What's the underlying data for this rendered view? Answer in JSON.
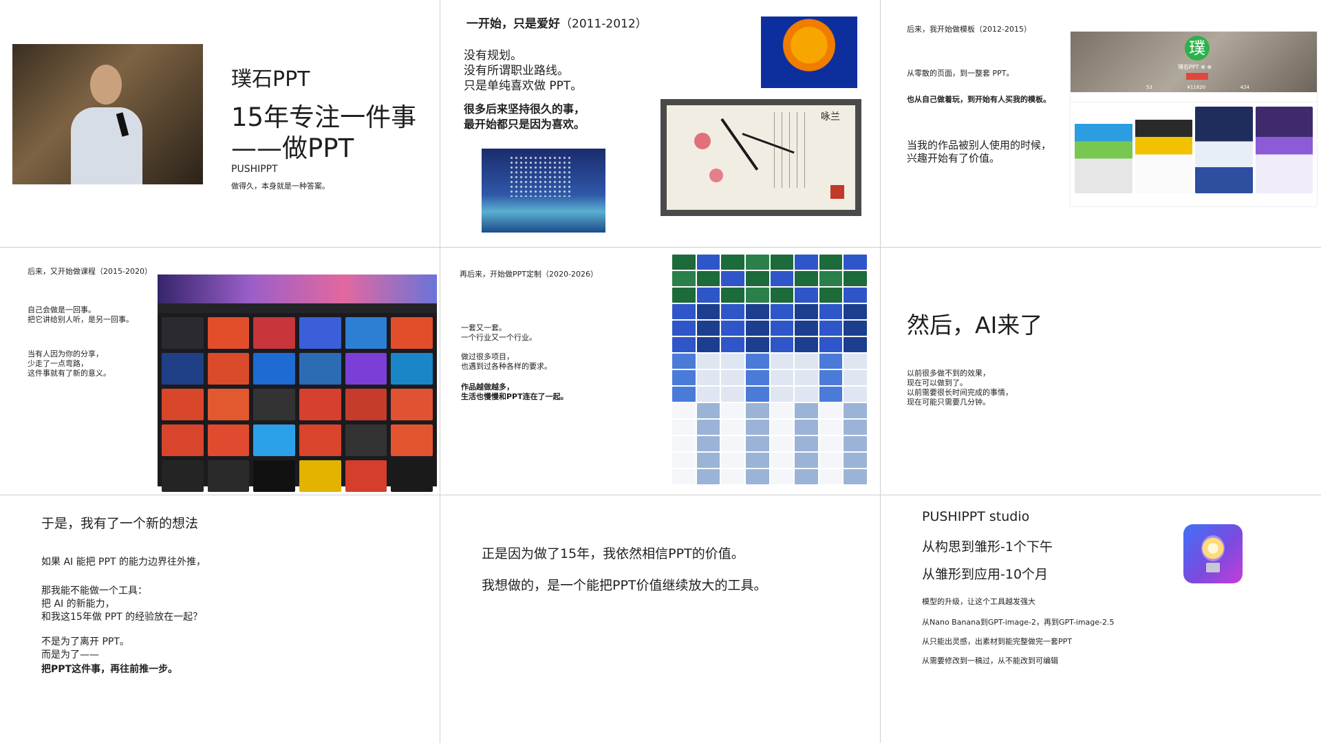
{
  "slide1": {
    "brand": "璞石PPT",
    "title_line1": "15年专注一件事",
    "title_line2": "——做PPT",
    "subtitle": "PUSHIPPT",
    "tagline": "做得久，本身就是一种答案。"
  },
  "slide2": {
    "heading_bold": "一开始，只是爱好",
    "heading_years": "（2011-2012）",
    "lines": [
      "没有规划。",
      "没有所谓职业路线。",
      "只是单纯喜欢做 PPT。"
    ],
    "bold_lines": [
      "很多后来坚持很久的事，",
      "最开始都只是因为喜欢。"
    ],
    "ink_title": "咏兰"
  },
  "slide3": {
    "heading": "后来，我开始做模板（2012-2015）",
    "line1": "从零散的页面，到一整套 PPT。",
    "bold_line": "也从自己做着玩，到开始有人买我的模板。",
    "lines2": [
      "当我的作品被别人使用的时候，",
      "兴趣开始有了价值。"
    ],
    "site": {
      "logo": "璞",
      "name": "璞石PPT ⊕ ⊕",
      "stats": [
        "53",
        "¥11820",
        "424"
      ]
    }
  },
  "slide4": {
    "heading": "后来，又开始做课程（2015-2020）",
    "lines1": [
      "自己会做是一回事。",
      "把它讲给别人听，是另一回事。"
    ],
    "lines2": [
      "当有人因为你的分享，",
      "少走了一点弯路，",
      "这件事就有了新的意义。"
    ]
  },
  "slide5": {
    "heading": "再后来，开始做PPT定制（2020-2026）",
    "lines1": [
      "一套又一套。",
      "一个行业又一个行业。"
    ],
    "lines2": [
      "做过很多项目，",
      "也遇到过各种各样的要求。"
    ],
    "bold_lines": [
      "作品越做越多，",
      "生活也慢慢和PPT连在了一起。"
    ]
  },
  "slide6": {
    "heading": "然后，AI来了",
    "lines": [
      "以前很多做不到的效果，",
      "现在可以做到了。",
      "以前需要很长时间完成的事情，",
      "现在可能只需要几分钟。"
    ]
  },
  "slide7": {
    "heading": "于是，我有了一个新的想法",
    "line1": "如果 AI 能把 PPT 的能力边界往外推，",
    "lines2": [
      "那我能不能做一个工具：",
      "把 AI 的新能力，",
      "和我这15年做 PPT 的经验放在一起？"
    ],
    "lines3": [
      "不是为了离开 PPT。",
      "而是为了——"
    ],
    "bold_line": "把PPT这件事，再往前推一步。"
  },
  "slide8": {
    "line1": "正是因为做了15年，我依然相信PPT的价值。",
    "line2": "我想做的，是一个能把PPT价值继续放大的工具。"
  },
  "slide9": {
    "title": "PUSHIPPT studio",
    "line1": "从构思到雏形-1个下午",
    "line2": "从雏形到应用-10个月",
    "points": [
      "模型的升级，让这个工具越发强大",
      "从Nano Banana到GPT-image-2，再到GPT-image-2.5",
      "从只能出灵感，出素材到能完整做完一套PPT",
      "从需要修改到一稿过，从不能改到可编辑"
    ]
  },
  "colors": {
    "text": "#1f1f1f",
    "divider": "#cfcfcf",
    "brand_green": "#2db14b",
    "course_bg": "#1b1b1f",
    "tiger_blue": "#0d2f9e",
    "icon_blue": "#3f71f7",
    "icon_purple": "#c33ed8"
  },
  "images": {
    "slide1": "speaker-photo",
    "slide2": [
      "tiger-poster",
      "ink-orchid-painting",
      "night-sky-illustration"
    ],
    "slide3": "template-store-screenshot",
    "slide4": "course-platform-screenshot",
    "slide5": "custom-ppt-mosaic",
    "slide9": "lightbulb-app-icon"
  }
}
